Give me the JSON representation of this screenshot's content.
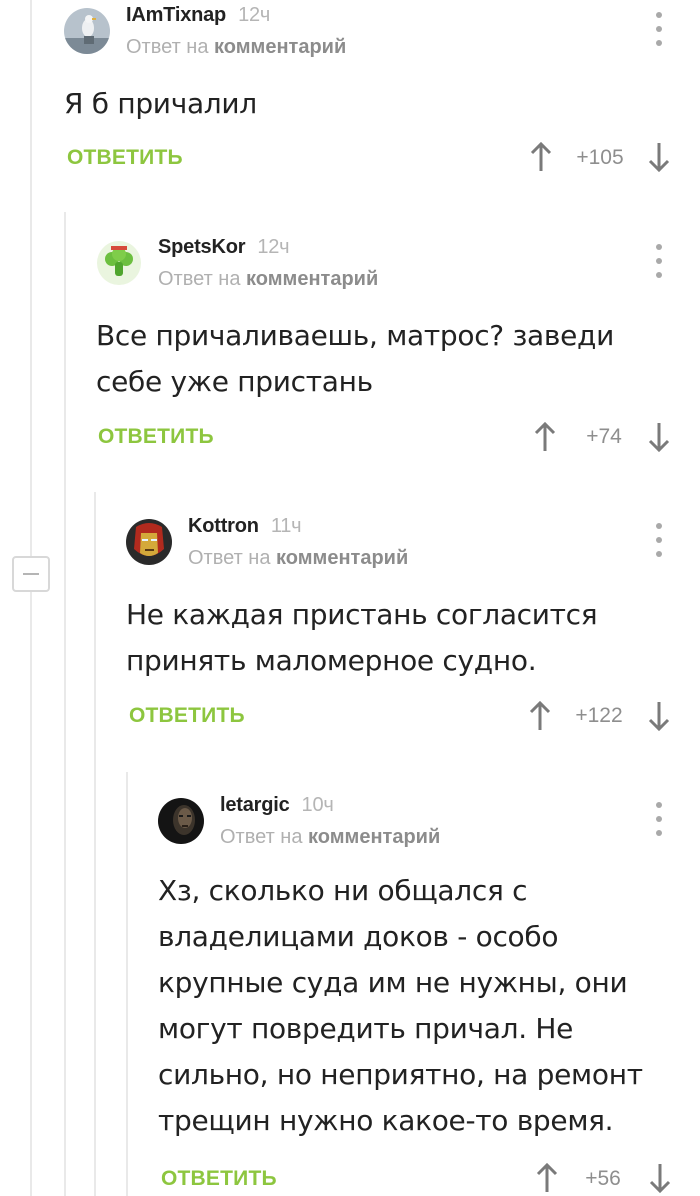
{
  "comments": [
    {
      "username": "IAmTixnap",
      "time": "12ч",
      "reply_prefix": "Ответ на",
      "reply_link": "комментарий",
      "text": "Я б причалил",
      "reply_label": "ОТВЕТИТЬ",
      "rating": "+105",
      "avatar": "seagull-avatar"
    },
    {
      "username": "SpetsKor",
      "time": "12ч",
      "reply_prefix": "Ответ на",
      "reply_link": "комментарий",
      "text": "Все причаливаешь, матрос? заведи себе уже пристань",
      "reply_label": "ОТВЕТИТЬ",
      "rating": "+74",
      "avatar": "broccoli-avatar"
    },
    {
      "username": "Kottron",
      "time": "11ч",
      "reply_prefix": "Ответ на",
      "reply_link": "комментарий",
      "text": "Не каждая пристань согласится принять маломерное судно.",
      "reply_label": "ОТВЕТИТЬ",
      "rating": "+122",
      "avatar": "iron-man-avatar"
    },
    {
      "username": "letargic",
      "time": "10ч",
      "reply_prefix": "Ответ на",
      "reply_link": "комментарий",
      "text": "Хз, сколько ни общался с владелицами доков - особо крупные суда им не нужны, они могут повредить причал. Не сильно, но неприятно, на ремонт трещин нужно какое-то время.",
      "reply_label": "ОТВЕТИТЬ",
      "rating": "+56",
      "avatar": "dark-face-avatar"
    }
  ],
  "colors": {
    "accent": "#8dc63f",
    "text": "#222222",
    "muted": "#b0b0b0",
    "guide": "#e9e9e9"
  },
  "icons": [
    "more-vertical-icon",
    "arrow-up-icon",
    "arrow-down-icon",
    "collapse-minus-icon"
  ]
}
